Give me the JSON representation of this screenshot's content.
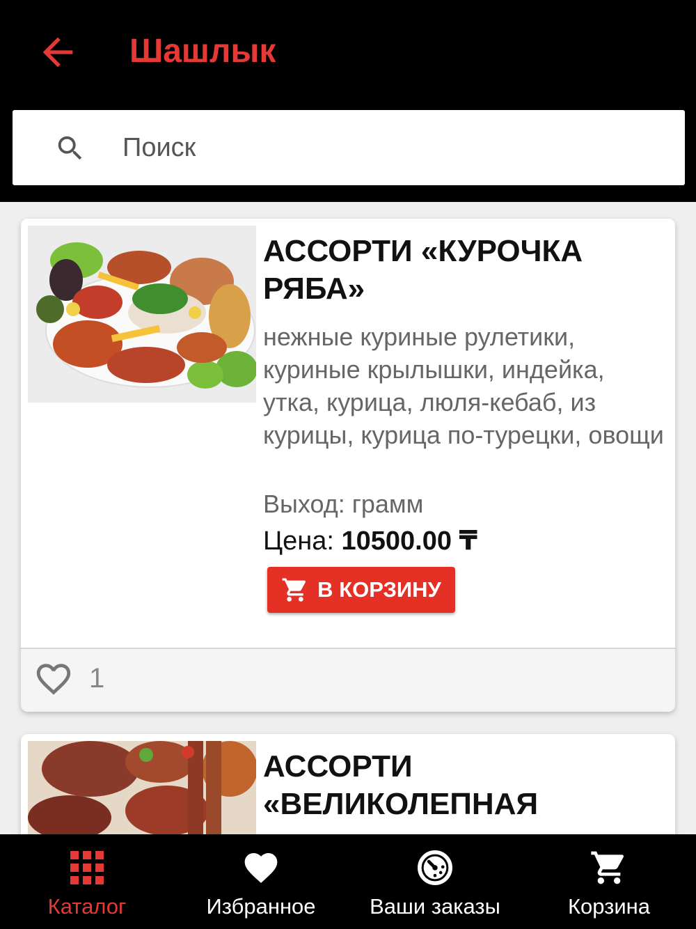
{
  "header": {
    "title": "Шашлык",
    "back_icon": "arrow-left-icon",
    "accent_color": "#e53935"
  },
  "search": {
    "placeholder": "Поиск",
    "icon": "search-icon"
  },
  "items": [
    {
      "name": "АССОРТИ «КУРОЧКА РЯБА»",
      "description": "нежные куриные рулетики, куриные крылышки, индейка, утка, курица, люля-кебаб, из курицы, курица по-турецки, овощи",
      "output": "Выход: грамм",
      "price_label": "Цена:",
      "price_value": "10500.00 ₸",
      "cart_button": "В КОРЗИНУ",
      "likes": "1"
    },
    {
      "name": "АССОРТИ «ВЕЛИКОЛЕПНАЯ"
    }
  ],
  "bottom_nav": [
    {
      "label": "Каталог",
      "icon": "grid-icon",
      "active": true
    },
    {
      "label": "Избранное",
      "icon": "heart-icon",
      "active": false
    },
    {
      "label": "Ваши заказы",
      "icon": "orders-clock-icon",
      "active": false
    },
    {
      "label": "Корзина",
      "icon": "cart-icon",
      "active": false
    }
  ]
}
